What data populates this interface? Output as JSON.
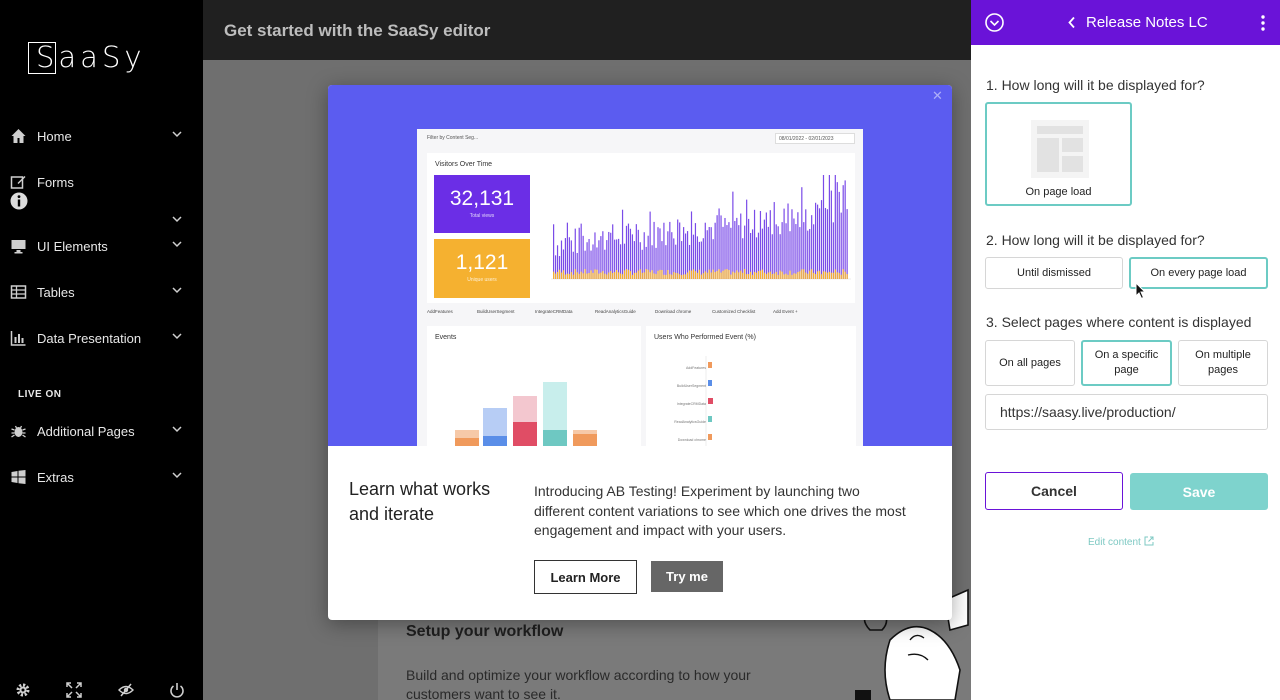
{
  "app": {
    "logo_text": "SaaSy",
    "topbar_title": "Get started with the SaaSy editor"
  },
  "sidebar": {
    "items": [
      {
        "label": "Home",
        "icon": "home-icon"
      },
      {
        "label": "Forms",
        "icon": "edit-icon"
      },
      {
        "label": "UI Elements",
        "icon": "monitor-icon"
      },
      {
        "label": "Tables",
        "icon": "table-icon"
      },
      {
        "label": "Data Presentation",
        "icon": "bar-chart-icon"
      }
    ],
    "section_label": "LIVE ON",
    "live_items": [
      {
        "label": "Additional Pages",
        "icon": "bug-icon"
      },
      {
        "label": "Extras",
        "icon": "windows-icon"
      }
    ],
    "footer_icons": [
      "settings-icon",
      "fullscreen-icon",
      "hide-icon",
      "power-icon"
    ]
  },
  "background": {
    "card_title": "Setup your workflow",
    "card_text": "Build and optimize your workflow according to how your customers want to see it."
  },
  "modal": {
    "heading": "Learn what works and iterate",
    "body": "Introducing AB Testing! Experiment by launching two different content variations to see which one drives the most engagement and impact with your users.",
    "learn_more_label": "Learn More",
    "try_me_label": "Try me",
    "dashboard": {
      "filter_label": "Filter by Content Seg...",
      "date_range": "08/01/2022 - 02/01/2023",
      "visitors_title": "Visitors Over Time",
      "total_views": "32,131",
      "total_views_label": "Total views",
      "unique_users": "1,121",
      "unique_users_label": "Unique users",
      "chips": [
        "AddFeatures",
        "BuildUserSegment",
        "IntegrateCRMData",
        "ReadAnalyticsGuide",
        "Download chrome",
        "Customized Checklist",
        "Add Event +"
      ],
      "events_title": "Events",
      "users_event_title": "Users Who Performed Event (%)",
      "event_rows": [
        "AddFeatures",
        "BuildUserSegment",
        "IntegrateCRMData",
        "ReadAnalyticsGuide",
        "Download chrome"
      ]
    }
  },
  "panel": {
    "title": "Release Notes LC",
    "q1": "1. How long will it be displayed for?",
    "q1_option": "On page load",
    "q2": "2. How long will it be displayed for?",
    "q2_options": [
      "Until dismissed",
      "On every page load"
    ],
    "q2_selected": "On every page load",
    "q3": "3. Select pages where content is displayed",
    "q3_options": [
      "On all pages",
      "On a specific page",
      "On multiple pages"
    ],
    "q3_selected": "On a specific page",
    "url_value": "https://saasy.live/production/",
    "cancel_label": "Cancel",
    "save_label": "Save",
    "edit_content_label": "Edit content",
    "colors": {
      "header": "#6a13d8",
      "accent": "#6ccbc4",
      "save": "#7ed3cd"
    }
  }
}
